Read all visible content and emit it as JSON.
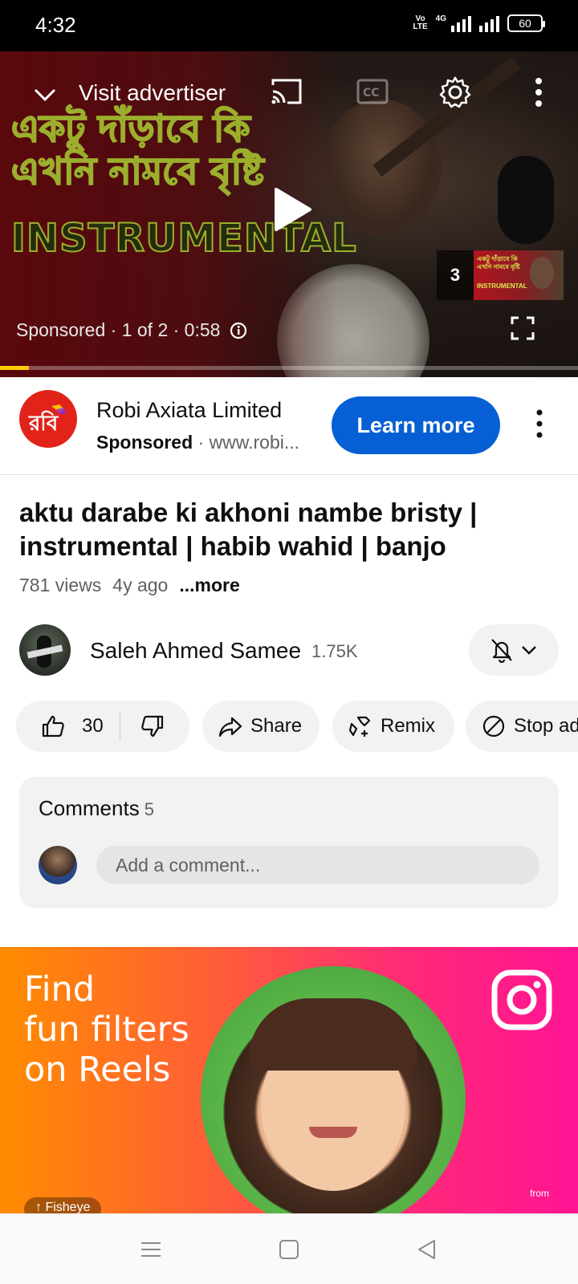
{
  "status_bar": {
    "time": "4:32",
    "volte": "Vo\nLTE",
    "net": "4G",
    "battery": "60"
  },
  "player": {
    "visit_advertiser": "Visit advertiser",
    "overlay_line1": "একটু দাঁড়াবে কি",
    "overlay_line2": "এখনি নামবে বৃষ্টি",
    "overlay_line3": "INSTRUMENTAL",
    "upnext_count": "3",
    "upnext_mini1": "একটু দাঁড়াবে কি এখনি নামবে বৃষ্টি",
    "upnext_mini2": "INSTRUMENTAL",
    "ad_info": "Sponsored · 1 of 2 · 0:58",
    "progress": 0.05
  },
  "ad": {
    "name": "Robi Axiata Limited",
    "sponsored": "Sponsored",
    "url": " · www.robi...",
    "cta": "Learn more",
    "logo_text": "রবি"
  },
  "video": {
    "title": "aktu darabe ki akhoni nambe bristy | instrumental | habib wahid | banjo",
    "views": "781 views",
    "age": "4y ago",
    "more": "...more"
  },
  "channel": {
    "name": "Saleh Ahmed Samee",
    "subscribers": "1.75K"
  },
  "actions": {
    "likes": "30",
    "share": "Share",
    "remix": "Remix",
    "stop_ads": "Stop ads"
  },
  "comments": {
    "title": "Comments",
    "count": "5",
    "placeholder": "Add a comment..."
  },
  "instagram_ad": {
    "headline": "Find\nfun filters\non Reels",
    "from": "from",
    "chip": "↑ Fisheye"
  },
  "colors": {
    "accent": "#065fd4",
    "progress": "#ffcc00",
    "ad_logo": "#e2231a"
  }
}
